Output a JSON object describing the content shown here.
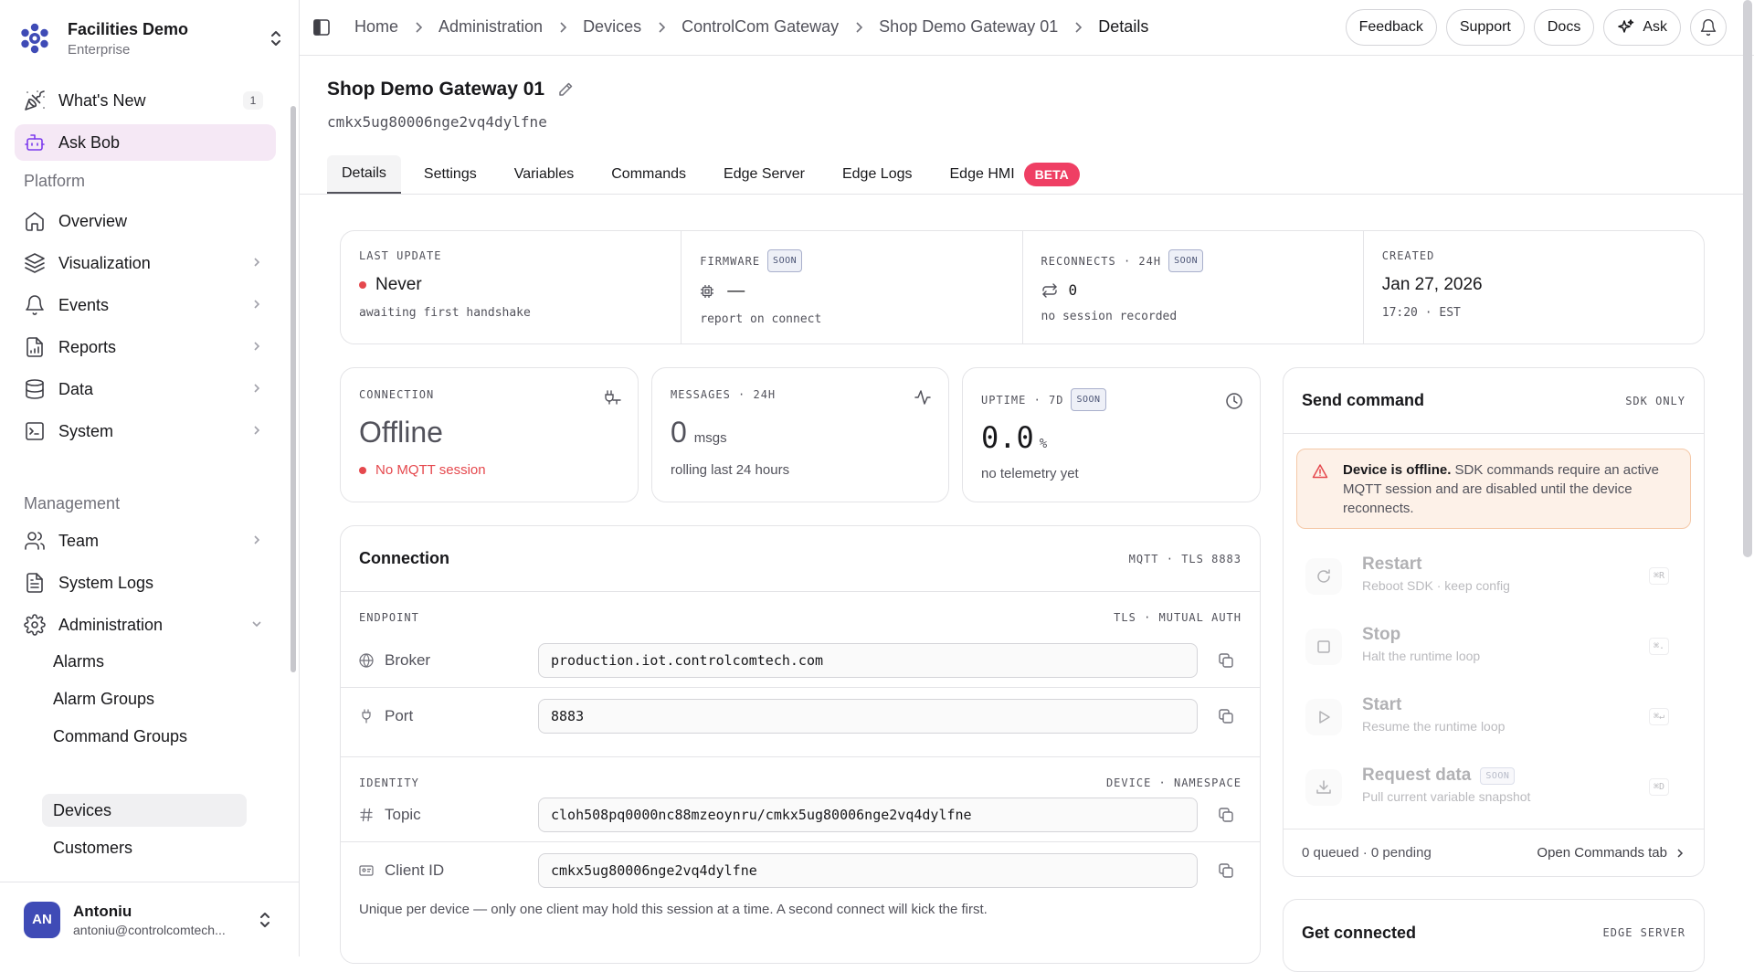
{
  "org": {
    "name": "Facilities Demo",
    "plan": "Enterprise"
  },
  "sidebar": {
    "top_items": [
      {
        "label": "What's New",
        "badge": "1"
      },
      {
        "label": "Ask Bob"
      }
    ],
    "platform_label": "Platform",
    "platform_items": [
      {
        "label": "Overview"
      },
      {
        "label": "Visualization"
      },
      {
        "label": "Events"
      },
      {
        "label": "Reports"
      },
      {
        "label": "Data"
      },
      {
        "label": "System"
      }
    ],
    "management_label": "Management",
    "management_items": [
      {
        "label": "Team"
      },
      {
        "label": "System Logs"
      },
      {
        "label": "Administration"
      }
    ],
    "admin_sub_items": [
      {
        "label": "Alarms"
      },
      {
        "label": "Alarm Groups"
      },
      {
        "label": "Command Groups"
      },
      {
        "label": "Devices"
      },
      {
        "label": "Customers"
      }
    ]
  },
  "user": {
    "initials": "AN",
    "name": "Antoniu",
    "email": "antoniu@controlcomtech..."
  },
  "breadcrumbs": [
    "Home",
    "Administration",
    "Devices",
    "ControlCom Gateway",
    "Shop Demo Gateway 01",
    "Details"
  ],
  "top_actions": {
    "feedback": "Feedback",
    "support": "Support",
    "docs": "Docs",
    "ask": "Ask"
  },
  "device": {
    "name": "Shop Demo Gateway 01",
    "id": "cmkx5ug80006nge2vq4dylfne"
  },
  "tabs": [
    {
      "label": "Details",
      "active": true
    },
    {
      "label": "Settings"
    },
    {
      "label": "Variables"
    },
    {
      "label": "Commands"
    },
    {
      "label": "Edge Server"
    },
    {
      "label": "Edge Logs"
    },
    {
      "label": "Edge HMI",
      "badge": "BETA"
    }
  ],
  "soon_label": "SOON",
  "stats": {
    "last_update": {
      "caption": "LAST UPDATE",
      "value": "Never",
      "sub": "awaiting first handshake"
    },
    "firmware": {
      "caption": "FIRMWARE",
      "value": "—",
      "sub": "report on connect"
    },
    "reconnects": {
      "caption": "RECONNECTS · 24H",
      "value": "0",
      "sub": "no session recorded"
    },
    "created": {
      "caption": "CREATED",
      "value": "Jan 27, 2026",
      "sub": "17:20 · EST"
    }
  },
  "connection_card": {
    "caption": "CONNECTION",
    "value": "Offline",
    "note": "No MQTT session"
  },
  "messages_card": {
    "caption": "MESSAGES · 24H",
    "value": "0",
    "unit": "msgs",
    "sub": "rolling last 24 hours"
  },
  "uptime_card": {
    "caption": "UPTIME · 7D",
    "value": "0.0",
    "unit": "%",
    "sub": "no telemetry yet"
  },
  "connection": {
    "title": "Connection",
    "meta": "MQTT · TLS 8883",
    "endpoint_label": "ENDPOINT",
    "endpoint_meta": "TLS · MUTUAL AUTH",
    "broker_label": "Broker",
    "broker_value": "production.iot.controlcomtech.com",
    "port_label": "Port",
    "port_value": "8883",
    "identity_label": "IDENTITY",
    "identity_meta": "DEVICE · NAMESPACE",
    "topic_label": "Topic",
    "topic_value": "cloh508pq0000nc88mzeoynru/cmkx5ug80006nge2vq4dylfne",
    "client_label": "Client ID",
    "client_value": "cmkx5ug80006nge2vq4dylfne",
    "hint": "Unique per device — only one client may hold this session at a time. A second connect will kick the first."
  },
  "send_command": {
    "title": "Send command",
    "meta": "SDK ONLY",
    "alert_bold": "Device is offline.",
    "alert_text": " SDK commands require an active MQTT session and are disabled until the device reconnects.",
    "commands": [
      {
        "title": "Restart",
        "sub": "Reboot SDK · keep config",
        "kbd": "⌘R"
      },
      {
        "title": "Stop",
        "sub": "Halt the runtime loop",
        "kbd": "⌘."
      },
      {
        "title": "Start",
        "sub": "Resume the runtime loop",
        "kbd": "⌘↵"
      },
      {
        "title": "Request data",
        "sub": "Pull current variable snapshot",
        "kbd": "⌘D",
        "soon": "SOON"
      }
    ],
    "queue_status": "0 queued · 0 pending",
    "open_link": "Open Commands tab"
  },
  "get_connected": {
    "title": "Get connected",
    "meta": "EDGE SERVER"
  },
  "colors": {
    "accent_red": "#e5484d",
    "beta_pink": "#ef3f64",
    "avatar_blue": "#3f4bb6",
    "active_nav": "#f5e8f5"
  }
}
